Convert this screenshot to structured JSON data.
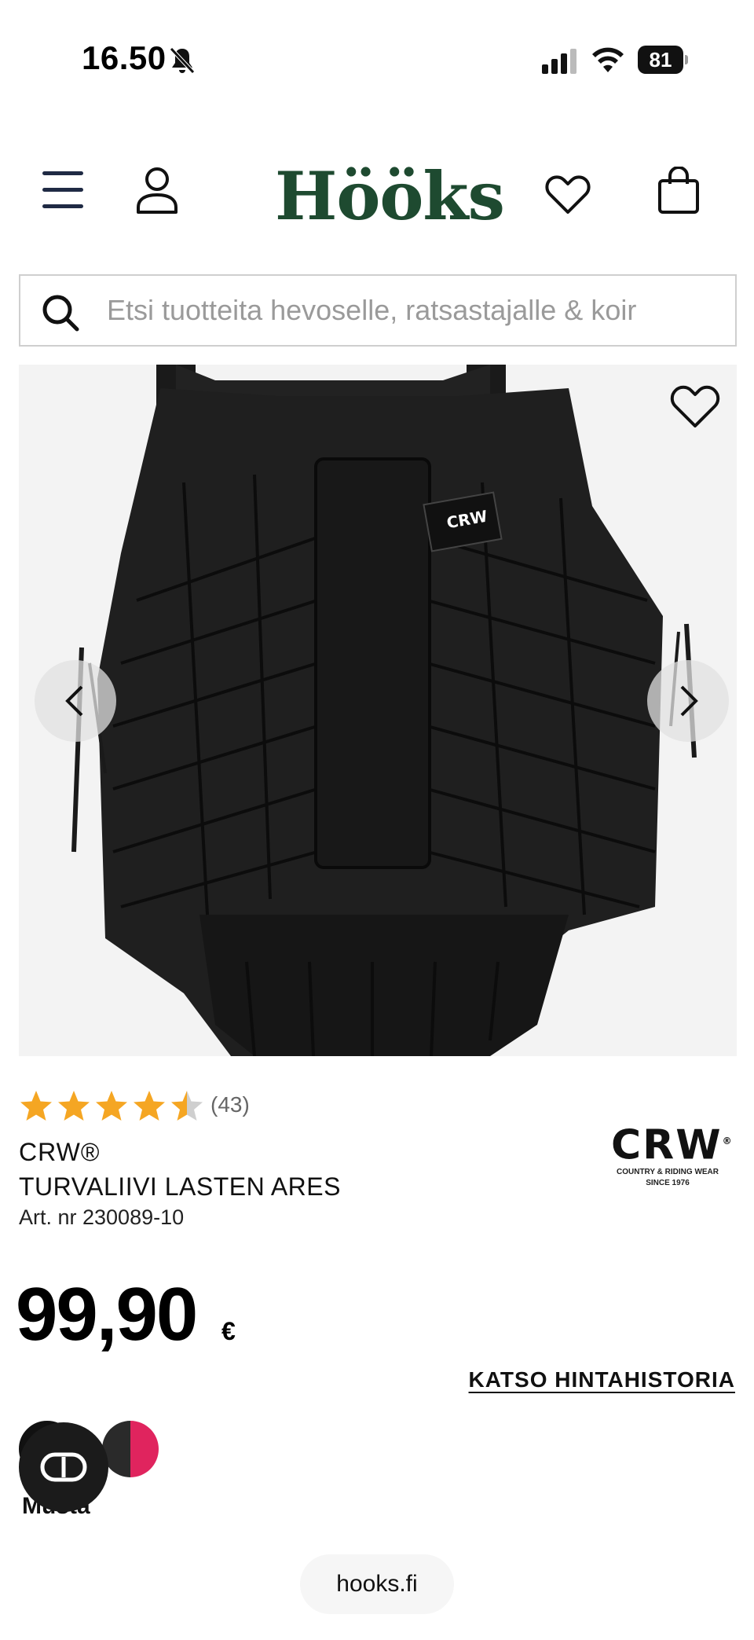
{
  "status_bar": {
    "time": "16.50",
    "battery": "81",
    "icons": [
      "mute-bell-icon",
      "signal-icon",
      "wifi-icon",
      "battery-icon"
    ]
  },
  "header": {
    "logo": "Hööks",
    "logo_color": "#1e4a30",
    "icons": [
      "menu-icon",
      "account-icon",
      "heart-icon",
      "shopping-bag-icon"
    ]
  },
  "search": {
    "placeholder": "Etsi tuotteita hevoselle, ratsastajalle & koir"
  },
  "product": {
    "image_label": "CRW",
    "rating_value": 4.5,
    "rating_max": 5,
    "rating_count": "(43)",
    "brand": "CRW®",
    "title": "TURVALIIVI LASTEN ARES",
    "article_number": "Art. nr 230089-10",
    "brand_logo": {
      "main": "CRW",
      "registered": "®",
      "sub_line1": "COUNTRY & RIDING WEAR",
      "sub_line2": "SINCE 1976"
    },
    "price": "99,90",
    "currency": "€",
    "price_history_link": "KATSO HINTAHISTORIA",
    "colors": [
      {
        "name": "Musta",
        "hex": "#111111",
        "selected": true
      },
      {
        "name": "Pink",
        "hex": "#e0245e",
        "selected": false
      }
    ],
    "selected_color_label": "Musta"
  },
  "browser": {
    "url": "hooks.fi"
  },
  "colors": {
    "star": "#f5a623",
    "star_empty": "#cfcfcf",
    "accent_pink": "#e0245e"
  }
}
